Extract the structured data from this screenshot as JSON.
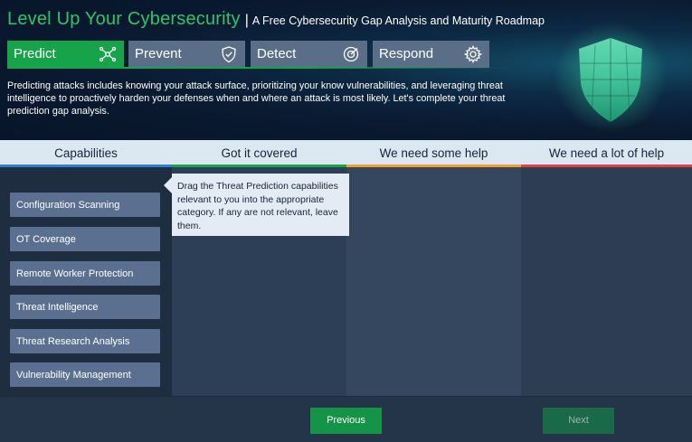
{
  "header": {
    "title": "Level Up Your Cybersecurity",
    "subtitle": "A Free Cybersecurity Gap Analysis and Maturity Roadmap",
    "description": "Predicting attacks includes knowing your attack surface, prioritizing your know vulnerabilities, and leveraging threat intelligence to proactively harden your defenses when and where an attack is most likely. Let's complete your threat prediction gap analysis."
  },
  "tabs": [
    {
      "label": "Predict",
      "icon": "network-icon",
      "active": true
    },
    {
      "label": "Prevent",
      "icon": "shield-check-icon",
      "active": false
    },
    {
      "label": "Detect",
      "icon": "radar-icon",
      "active": false
    },
    {
      "label": "Respond",
      "icon": "gear-icon",
      "active": false
    }
  ],
  "columns": {
    "capabilities": "Capabilities",
    "covered": "Got it covered",
    "some_help": "We need some help",
    "lot_help": "We need a lot of help"
  },
  "column_colors": {
    "capabilities": "#2f80c8",
    "covered": "#16a34a",
    "some_help": "#f0a030",
    "lot_help": "#e04040"
  },
  "capabilities": [
    "Configuration Scanning",
    "OT Coverage",
    "Remote Worker Protection",
    "Threat Intelligence",
    "Threat Research Analysis",
    "Vulnerability Management"
  ],
  "tooltip": "Drag the Threat Prediction capabilities relevant to you into the appropriate category. If any are not relevant, leave them.",
  "buttons": {
    "previous": "Previous",
    "next": "Next"
  }
}
